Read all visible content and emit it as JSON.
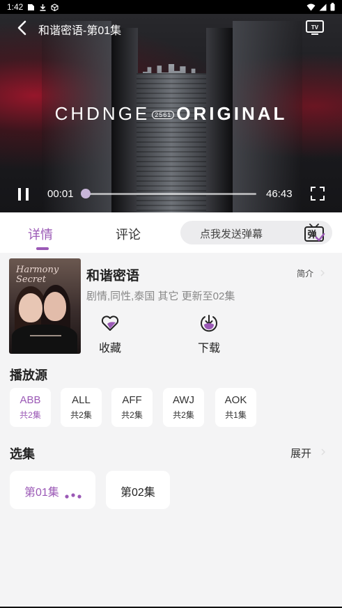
{
  "status_bar": {
    "time": "1:42"
  },
  "player": {
    "title": "和谐密语-第01集",
    "overlay": {
      "left": "CHDNGE",
      "mid": "2561",
      "right": "ORIGINAL"
    },
    "current_time": "00:01",
    "total_time": "46:43",
    "progress": 0.0,
    "accent": "#a57fc0"
  },
  "tabs": {
    "detail": "详情",
    "comment": "评论",
    "danmaku_placeholder": "点我发送弹幕",
    "danmaku_button": "弹"
  },
  "show": {
    "poster_title": "Harmony Secret",
    "title": "和谐密语",
    "intro": "简介",
    "meta": "剧情,同性,泰国 其它 更新至02集",
    "favorite": "收藏",
    "download": "下载"
  },
  "sources": {
    "title": "播放源",
    "items": [
      {
        "name": "ABB",
        "count": "共2集"
      },
      {
        "name": "ALL",
        "count": "共2集"
      },
      {
        "name": "AFF",
        "count": "共2集"
      },
      {
        "name": "AWJ",
        "count": "共2集"
      },
      {
        "name": "AOK",
        "count": "共1集"
      }
    ]
  },
  "episodes": {
    "title": "选集",
    "expand": "展开",
    "items": [
      {
        "label": "第01集"
      },
      {
        "label": "第02集"
      }
    ]
  },
  "colors": {
    "accent": "#9b59b6",
    "background": "#f4f4f5"
  }
}
